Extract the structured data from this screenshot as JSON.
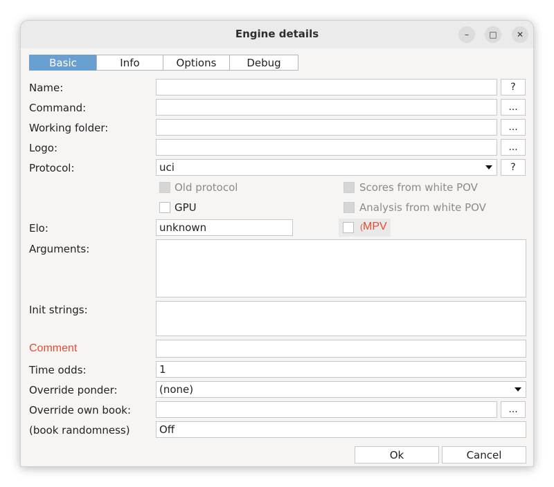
{
  "window": {
    "title": "Engine details",
    "controls": {
      "minimize": "–",
      "maximize": "□",
      "close": "✕"
    }
  },
  "tabs": [
    "Basic",
    "Info",
    "Options",
    "Debug"
  ],
  "form": {
    "name": {
      "label": "Name:",
      "value": "",
      "help": "?"
    },
    "command": {
      "label": "Command:",
      "value": "",
      "browse": "..."
    },
    "working_folder": {
      "label": "Working folder:",
      "value": "",
      "browse": "..."
    },
    "logo": {
      "label": "Logo:",
      "value": "",
      "browse": "..."
    },
    "protocol": {
      "label": "Protocol:",
      "value": "uci",
      "help": "?"
    },
    "checkboxes": {
      "old_protocol": "Old protocol",
      "gpu": "GPU",
      "scores_white_pov": "Scores from white POV",
      "analysis_white_pov": "Analysis from white POV",
      "mpv": "MPV",
      "mpv_prefix": "("
    },
    "elo": {
      "label": "Elo:",
      "value": "unknown"
    },
    "arguments": {
      "label": "Arguments:",
      "value": ""
    },
    "init_strings": {
      "label": "Init strings:",
      "value": ""
    },
    "comment": {
      "label": "Comment",
      "value": ""
    },
    "time_odds": {
      "label": "Time odds:",
      "value": "1"
    },
    "override_ponder": {
      "label": "Override ponder:",
      "value": "(none)"
    },
    "override_book": {
      "label": "Override own book:",
      "value": "",
      "browse": "..."
    },
    "book_randomness": {
      "label": "(book randomness)",
      "value": "Off"
    }
  },
  "buttons": {
    "ok": "Ok",
    "cancel": "Cancel"
  },
  "colors": {
    "active_tab": "#6a9fd2",
    "highlight_label": "#e64a2e"
  }
}
